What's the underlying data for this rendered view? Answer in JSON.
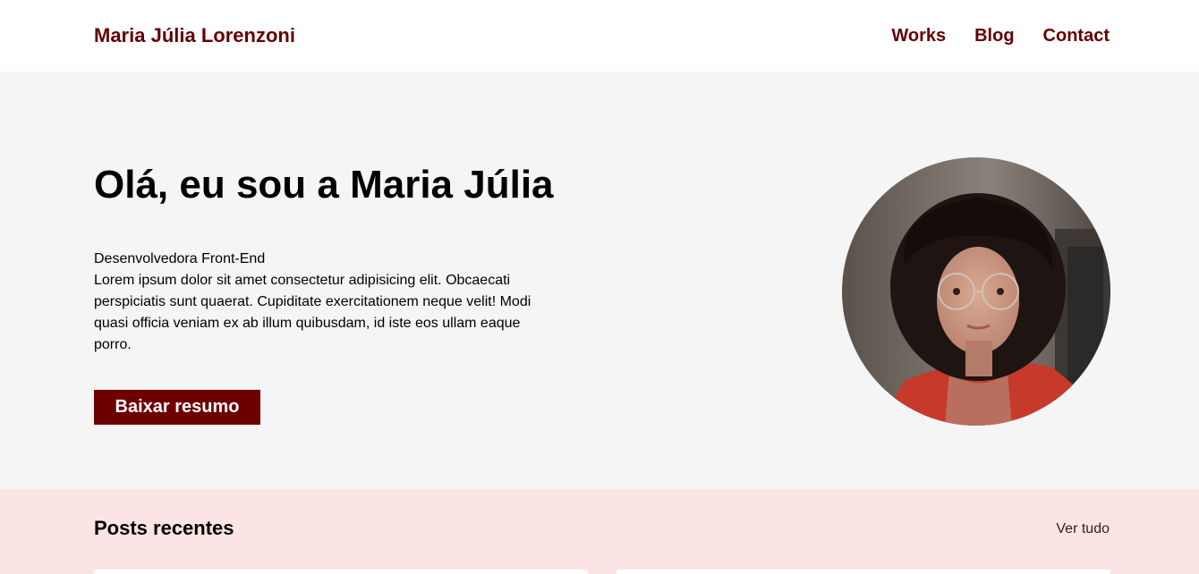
{
  "header": {
    "brand": "Maria Júlia Lorenzoni",
    "nav": [
      "Works",
      "Blog",
      "Contact"
    ]
  },
  "hero": {
    "title": "Olá, eu sou a Maria Júlia",
    "role": "Desenvolvedora Front-End",
    "description": "Lorem ipsum dolor sit amet consectetur adipisicing elit. Obcaecati perspiciatis sunt quaerat. Cupiditate exercitationem neque velit! Modi quasi officia veniam ex ab illum quibusdam, id iste eos ullam eaque porro.",
    "button_label": "Baixar resumo"
  },
  "posts": {
    "title": "Posts recentes",
    "see_all": "Ver tudo"
  },
  "colors": {
    "brand": "#640000",
    "button": "#6e0000",
    "hero_bg": "#f5f5f5",
    "posts_bg": "#fce4e4"
  },
  "icons": {
    "avatar": "profile-photo"
  }
}
